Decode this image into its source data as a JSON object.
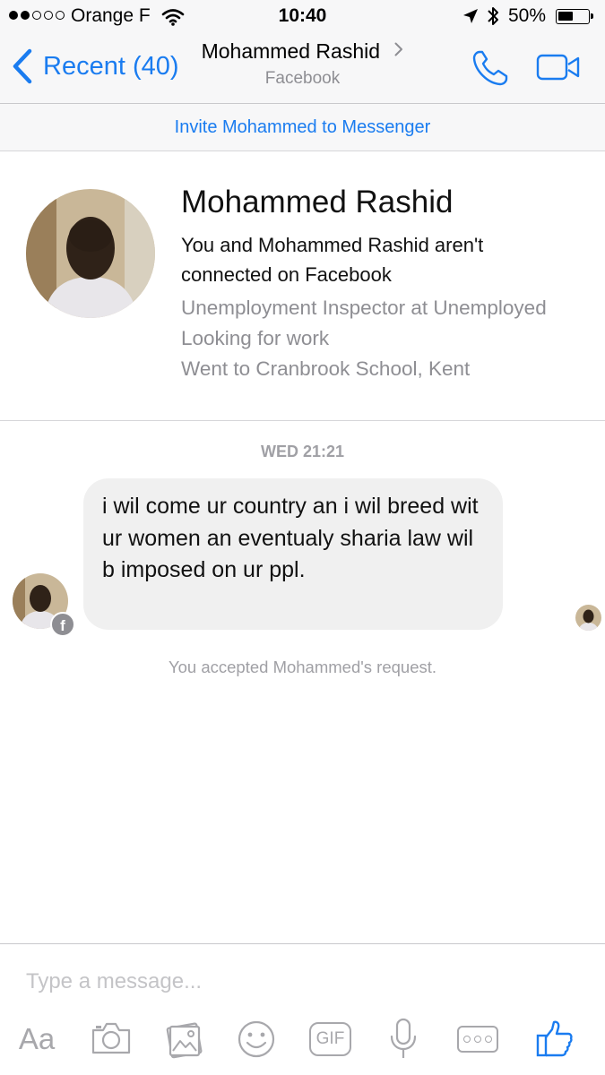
{
  "status_bar": {
    "carrier": "Orange F",
    "time": "10:40",
    "battery": "50%",
    "battery_level": 0.5,
    "signal_bars_filled": 2,
    "signal_bars_total": 5
  },
  "nav": {
    "back_label": "Recent (40)",
    "title": "Mohammed Rashid",
    "subtitle": "Facebook"
  },
  "invite_banner": "Invite Mohammed to Messenger",
  "profile": {
    "name": "Mohammed Rashid",
    "connection": "You and Mohammed Rashid aren't connected on Facebook",
    "work": "Unemployment Inspector at Unemployed Looking for work",
    "education": "Went to Cranbrook School, Kent"
  },
  "conversation": {
    "timestamp": "WED 21:21",
    "message": "i wil come ur country an i wil breed wit ur women an eventualy sharia law wil b imposed on ur ppl.",
    "system_note": "You accepted Mohammed's request."
  },
  "composer": {
    "placeholder": "Type a message...",
    "aa_label": "Aa",
    "gif_label": "GIF"
  },
  "colors": {
    "accent": "#1a7cf0",
    "bubble": "#f0f0f0",
    "muted_text": "#8e8e93",
    "icon_gray": "#a8a8ac"
  }
}
